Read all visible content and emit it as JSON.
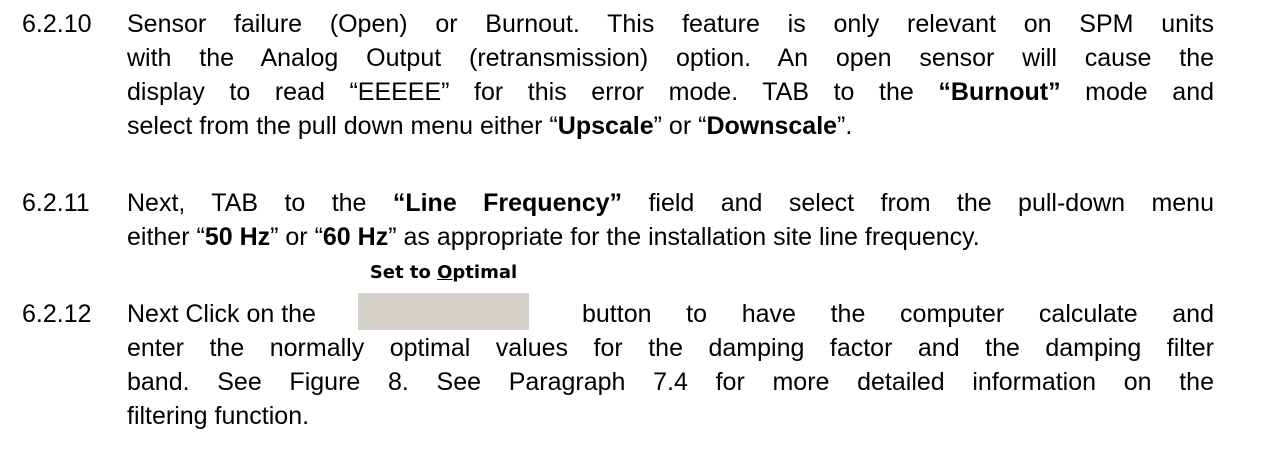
{
  "sections": {
    "s6_2_10": {
      "number": "6.2.10",
      "l1": "Sensor failure (Open) or Burnout.  This feature is only relevant on SPM units",
      "l2": "with the Analog Output (retransmission) option.  An open sensor will cause the",
      "l3": "display to read “EEEEE” for this error mode.  TAB to the ",
      "l3_bold": "“Burnout”",
      "l3_end": " mode and",
      "l4_a": "select from the pull down menu either “",
      "l4_bold1": "Upscale",
      "l4_b": "” or “",
      "l4_bold2": "Downscale",
      "l4_c": "”."
    },
    "s6_2_11": {
      "number": "6.2.11",
      "l1_a": "Next, TAB to the ",
      "l1_bold": "“Line Frequency”",
      "l1_b": " field and select from the pull-down menu",
      "l2_a": "either “",
      "l2_bold1": "50 Hz",
      "l2_b": "” or “",
      "l2_bold2": "60 Hz",
      "l2_c": "” as appropriate for the installation site line frequency."
    },
    "s6_2_12": {
      "number": "6.2.12",
      "l1_a": "Next Click on the",
      "button_pre": "Set to ",
      "button_underlined": "O",
      "button_post": "ptimal",
      "l1_b": "button to have the computer calculate and",
      "l2": "enter the normally optimal values for the damping factor and the damping filter",
      "l3": "band.  See Figure 8.  See Paragraph 7.4 for more detailed information on the",
      "l4": "filtering function."
    }
  }
}
